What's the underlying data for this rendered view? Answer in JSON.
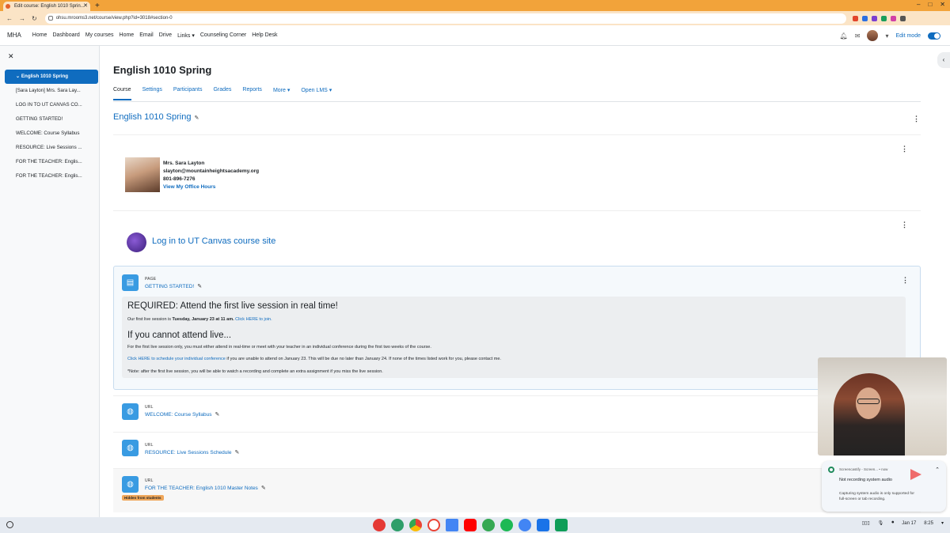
{
  "browser": {
    "tab_title": "Edit course: English 1010 Sprin...",
    "url": "ohsu.mrooms3.net/course/view.php?id=3018#section-0"
  },
  "topnav": {
    "brand": "MHA",
    "links": [
      "Home",
      "Dashboard",
      "My courses",
      "Home",
      "Email",
      "Drive",
      "Links ▾",
      "Counseling Corner",
      "Help Desk"
    ],
    "edit_mode_label": "Edit mode"
  },
  "drawer": {
    "items": [
      "English 1010 Spring",
      "[Sara Layton] Mrs. Sara Lay...",
      "LOG IN TO UT CANVAS CO...",
      "GETTING STARTED!",
      "WELCOME: Course Syllabus",
      "RESOURCE: Live Sessions ...",
      "FOR THE TEACHER: Englis...",
      "FOR THE TEACHER: Englis..."
    ]
  },
  "course": {
    "title": "English 1010 Spring",
    "tabs": [
      "Course",
      "Settings",
      "Participants",
      "Grades",
      "Reports",
      "More ▾",
      "Open LMS ▾"
    ],
    "section_title": "English 1010 Spring"
  },
  "teacher": {
    "name": "Mrs. Sara Layton",
    "email": "slayton@mountainheightsacademy.org",
    "phone": "801-896-7276",
    "office_hours": "View My Office Hours"
  },
  "canvas_link": "Log in to UT Canvas course site",
  "page_activity": {
    "type": "PAGE",
    "name": "GETTING STARTED!",
    "required_title": "REQUIRED: Attend the first live session in real time!",
    "first_session_prefix": "Our first live session is ",
    "first_session_date": "Tuesday, January 23 at 11 am.",
    "click_join": "Click HERE to join.",
    "cannot_title": "If you cannot attend live...",
    "cannot_text": "For the first live session only, you must either attend in real-time or meet with your teacher in an individual conference during the first two weeks of the course.",
    "schedule_link": "Click HERE to schedule your individual conference",
    "schedule_text": " if you are unable to attend on January 23. This will be due no later than January 24. If none of the times listed work for you, please contact me.",
    "note": "*Note: after the first live session, you will be able to watch a recording and complete an extra assignment if you miss the live session."
  },
  "url_activities": [
    {
      "type": "URL",
      "name": "WELCOME: Course Syllabus"
    },
    {
      "type": "URL",
      "name": "RESOURCE: Live Sessions Schedule"
    },
    {
      "type": "URL",
      "name": "FOR THE TEACHER: English 1010 Master Notes",
      "badge": "Hidden from students"
    }
  ],
  "notification": {
    "app": "Screencastify - Screen... • now",
    "title": "Not recording system audio",
    "body": "Capturing system audio is only supported for full-screen or tab recording."
  },
  "taskbar": {
    "date": "Jan 17",
    "time": "8:25"
  }
}
